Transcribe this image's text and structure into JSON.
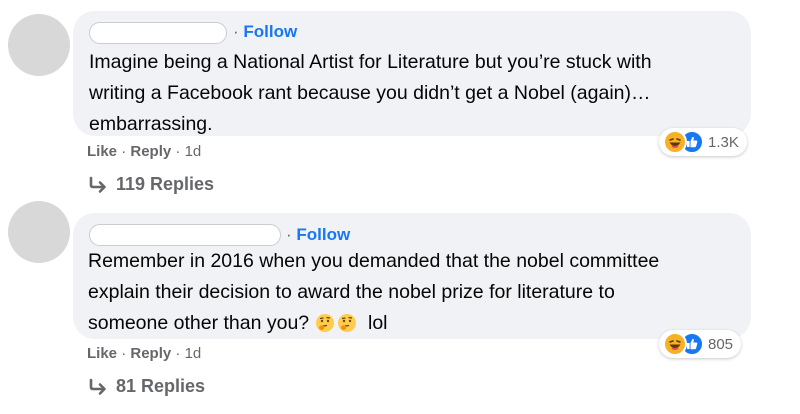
{
  "comments": [
    {
      "follow_separator": "·",
      "follow_label": "Follow",
      "text_lines": [
        "Imagine being a National Artist for Literature but you’re stuck with",
        "writing a Facebook rant because you didn’t get a Nobel (again)…",
        "embarrassing."
      ],
      "reaction_count": "1.3K",
      "like_label": "Like",
      "reply_label": "Reply",
      "dot": "·",
      "age": "1d",
      "replies_label": "119 Replies"
    },
    {
      "follow_separator": "·",
      "follow_label": "Follow",
      "text_lines": [
        "Remember in 2016 when you demanded that the nobel committee",
        "explain their decision to award the nobel prize for literature to",
        "someone other than you?",
        "lol"
      ],
      "reaction_count": "805",
      "like_label": "Like",
      "reply_label": "Reply",
      "dot": "·",
      "age": "1d",
      "replies_label": "81 Replies"
    }
  ],
  "icons": {
    "haha": "haha-reaction-icon",
    "like": "like-reaction-icon",
    "thinking_emoji": "thinking-face-emoji",
    "reply_arrow": "reply-arrow-icon"
  },
  "colors": {
    "link_blue": "#1877f2",
    "bubble_bg": "#f0f2f5",
    "meta_gray": "#65676b",
    "haha_yellow": "#f7b125"
  }
}
